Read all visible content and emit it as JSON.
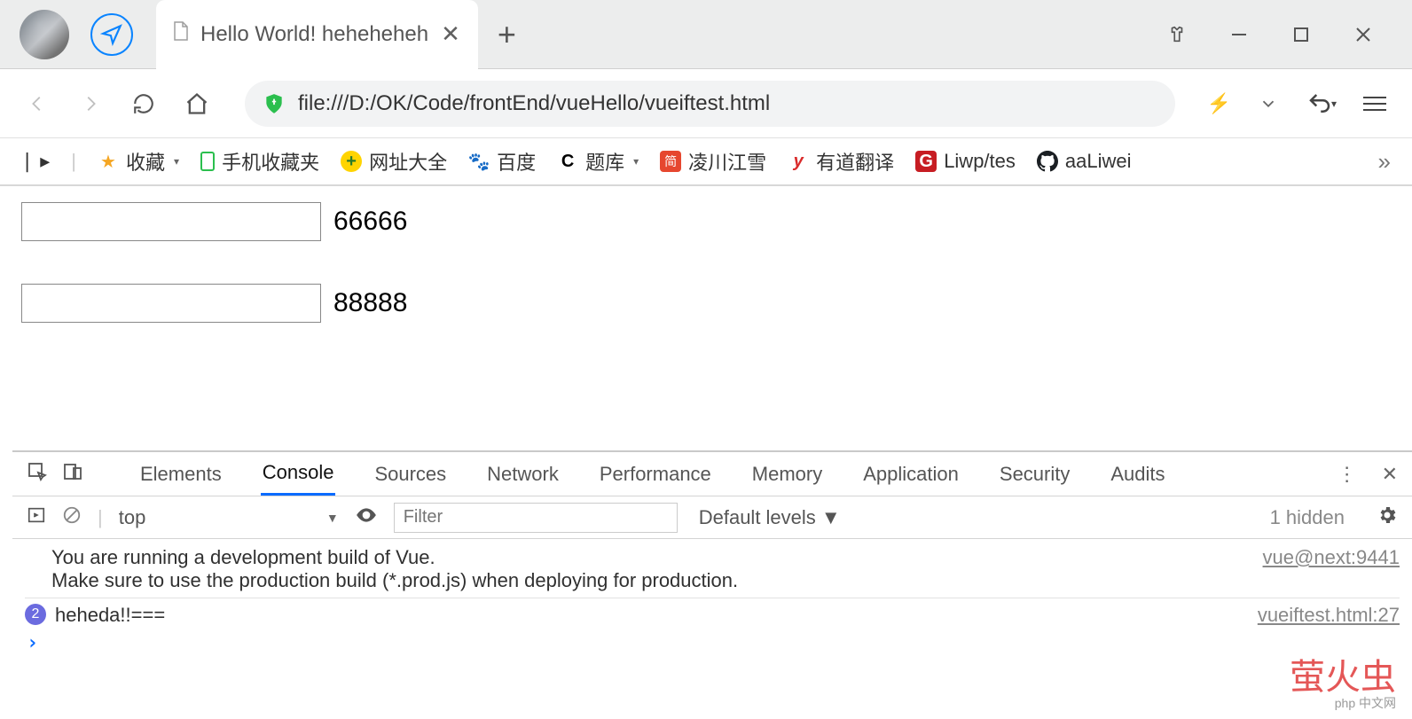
{
  "titlebar": {
    "tab_title": "Hello World! heheheheh"
  },
  "nav": {
    "url": "file:///D:/OK/Code/frontEnd/vueHello/vueiftest.html"
  },
  "bookmarks": {
    "toggle": "▸",
    "fav": "收藏",
    "mobile": "手机收藏夹",
    "site_all": "网址大全",
    "baidu": "百度",
    "tiku": "题库",
    "ling": "凌川江雪",
    "youdao": "有道翻译",
    "liwp": "Liwp/tes",
    "aaliwei": "aaLiwei"
  },
  "page": {
    "val1": "66666",
    "val2": "88888"
  },
  "devtools": {
    "tabs": [
      "Elements",
      "Console",
      "Sources",
      "Network",
      "Performance",
      "Memory",
      "Application",
      "Security",
      "Audits"
    ],
    "active_tab": "Console",
    "context": "top",
    "filter_placeholder": "Filter",
    "levels": "Default levels ▼",
    "hidden": "1 hidden",
    "log": [
      {
        "count": null,
        "msg": "You are running a development build of Vue.\nMake sure to use the production build (*.prod.js) when deploying for production.",
        "src": "vue@next:9441"
      },
      {
        "count": 2,
        "msg": "heheda!!===",
        "src": "vueiftest.html:27"
      }
    ],
    "prompt": "›"
  },
  "watermark": {
    "big": "萤火虫",
    "small": "php 中文网"
  }
}
